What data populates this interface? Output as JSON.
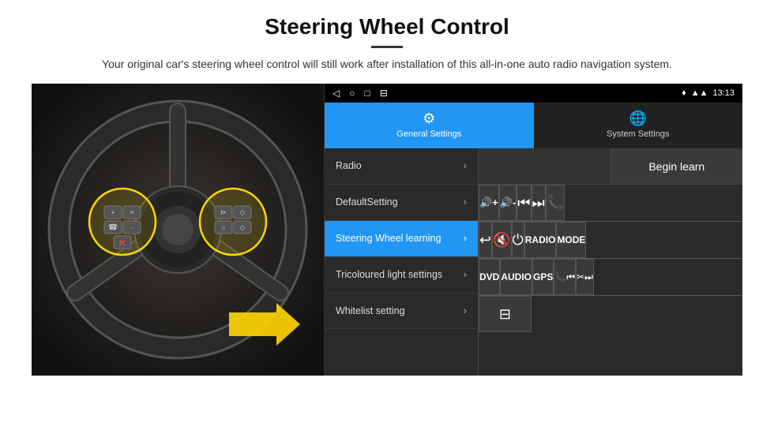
{
  "header": {
    "title": "Steering Wheel Control",
    "subtitle": "Your original car's steering wheel control will still work after installation of this all-in-one auto radio navigation system."
  },
  "status_bar": {
    "nav_back": "◁",
    "nav_home": "○",
    "nav_recents": "□",
    "nav_menu": "⊟",
    "location_icon": "♦",
    "signal_icon": "▲",
    "time": "13:13"
  },
  "tabs": [
    {
      "id": "general",
      "label": "General Settings",
      "icon": "⚙",
      "active": true
    },
    {
      "id": "system",
      "label": "System Settings",
      "icon": "🌐",
      "active": false
    }
  ],
  "menu_items": [
    {
      "id": "radio",
      "label": "Radio",
      "active": false
    },
    {
      "id": "default",
      "label": "DefaultSetting",
      "active": false
    },
    {
      "id": "steering",
      "label": "Steering Wheel learning",
      "active": true
    },
    {
      "id": "tricoloured",
      "label": "Tricoloured light settings",
      "active": false
    },
    {
      "id": "whitelist",
      "label": "Whitelist setting",
      "active": false
    }
  ],
  "controls": {
    "begin_learn": "Begin learn",
    "buttons_row1": [
      "🔊+",
      "🔊-",
      "⏮",
      "⏭",
      "📞"
    ],
    "buttons_row2": [
      "↩",
      "🔇",
      "⏻",
      "RADIO",
      "MODE"
    ],
    "buttons_row3_labels": [
      "DVD",
      "AUDIO",
      "GPS",
      "📞⏮",
      "✂⏭"
    ],
    "last_row": [
      "⊟"
    ]
  }
}
